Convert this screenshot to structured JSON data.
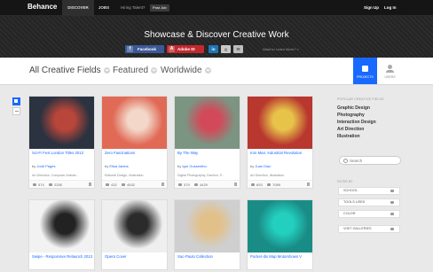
{
  "topbar": {
    "logo": "Behance",
    "nav": [
      "DISCOVER",
      "JOBS"
    ],
    "hiring": "Hiring Talent?",
    "post_job": "Post Job",
    "sign_up": "Sign Up",
    "log_in": "Log In"
  },
  "hero": {
    "title": "Showcase & Discover Creative Work",
    "share": {
      "facebook": "Facebook",
      "adobe": "Adobe ID",
      "linkedin": "in",
      "google": "g",
      "mail": "✉"
    },
    "learn_more": "Want to Learn More? »"
  },
  "filters": {
    "all": "All Creative Fields",
    "featured": "Featured",
    "worldwide": "Worldwide"
  },
  "view_toggle": {
    "projects": "PROJECTS",
    "users": "USERS"
  },
  "projects": [
    {
      "title": "Sci-Fi Fest London Titles 2013",
      "by": "by",
      "author": "Jordi Pagès",
      "fields": "Art Direction, Computer Animat...",
      "likes": "574",
      "views": "2255",
      "thumb_color": "#2b3240",
      "thumb_accent": "#b8463a"
    },
    {
      "title": "Zero Fascinations",
      "by": "by",
      "author": "Elisa Jabins",
      "fields": "Editorial Design, Illustration",
      "likes": "432",
      "views": "4532",
      "thumb_color": "#e06a56",
      "thumb_accent": "#f3d7c8"
    },
    {
      "title": "By The Way",
      "by": "by",
      "author": "Igor Gussentho",
      "fields": "Digital Photography, Fashion, P...",
      "likes": "379",
      "views": "4429",
      "thumb_color": "#7c9482",
      "thumb_accent": "#d24a5a"
    },
    {
      "title": "Iron Man: Industrial Revolution",
      "by": "by",
      "author": "Juan Diaz",
      "fields": "Art Direction, Illustration",
      "likes": "693",
      "views": "7089",
      "thumb_color": "#b8372f",
      "thumb_accent": "#e8c34a"
    },
    {
      "title": "Swipe - Responsive Relaunch 2013",
      "by": "",
      "author": "",
      "fields": "",
      "likes": "",
      "views": "",
      "thumb_color": "#f2f2f2",
      "thumb_accent": "#222222"
    },
    {
      "title": "Opera Cover",
      "by": "",
      "author": "",
      "fields": "",
      "likes": "",
      "views": "",
      "thumb_color": "#efefef",
      "thumb_accent": "#2b2b2b"
    },
    {
      "title": "Sao Paulo Collection",
      "by": "",
      "author": "",
      "fields": "",
      "likes": "",
      "views": "",
      "thumb_color": "#cfcfcf",
      "thumb_accent": "#e2c08a"
    },
    {
      "title": "Pocket-dis Map Motorshows V",
      "by": "",
      "author": "",
      "fields": "",
      "likes": "",
      "views": "",
      "thumb_color": "#1a8c86",
      "thumb_accent": "#23d0c0"
    }
  ],
  "sidebar": {
    "popular_heading": "POPULAR CREATIVE FIELDS",
    "popular": [
      "Graphic Design",
      "Photography",
      "Interaction Design",
      "Art Direction",
      "Illustration"
    ],
    "search_placeholder": "Search",
    "filter_heading": "FILTER BY",
    "filters": [
      "SCHOOL",
      "TOOLS USED",
      "COLOR",
      "VISIT GALLERIES"
    ]
  },
  "colors": {
    "brand": "#1769ff",
    "topbar": "#151515"
  }
}
